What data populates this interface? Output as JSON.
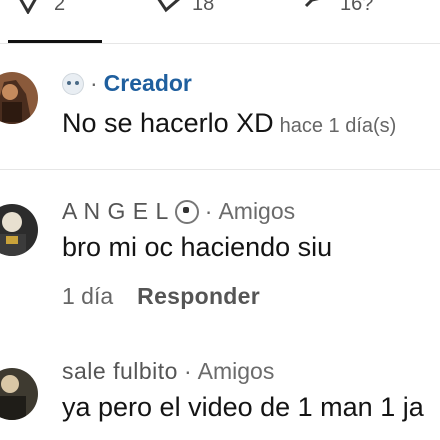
{
  "topbar": {
    "items": [
      {
        "count": "2"
      },
      {
        "count": "18"
      },
      {
        "count": "16?"
      }
    ]
  },
  "comments": [
    {
      "author": "",
      "role": "Creador",
      "text": "No se hacerlo XD",
      "time": "hace 1 día(s)"
    },
    {
      "author": "A N G E L",
      "role": "Amigos",
      "text": "bro mi oc haciendo siu",
      "time": "1 día",
      "reply": "Responder"
    },
    {
      "author": "sale fulbito",
      "role": "Amigos",
      "text": "ya pero el video de 1 man 1 ja"
    }
  ],
  "separators": {
    "dot": "·"
  }
}
